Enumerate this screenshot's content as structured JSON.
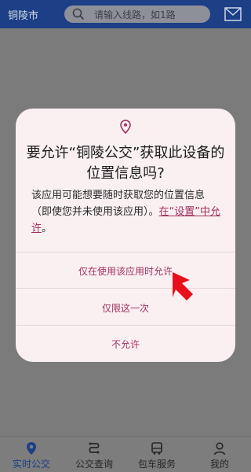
{
  "header": {
    "city": "铜陵市",
    "search_placeholder": "请输入线路，如1路",
    "search_icon": "search-icon",
    "mail_icon": "mail-icon"
  },
  "dialog": {
    "title_line1": "要允许“铜陵公交”获取此设备的",
    "title_line2": "位置信息吗?",
    "message_part1": "该应用可能想要随时获取您的位置信息（即使您并未使用该应用）。",
    "message_link": "在“设置”中允许",
    "message_end": "。",
    "options": [
      {
        "label": "仅在使用该应用时允许"
      },
      {
        "label": "仅限这一次"
      },
      {
        "label": "不允许"
      }
    ]
  },
  "tabs": [
    {
      "label": "实时公交",
      "icon": "location-pin-icon",
      "active": true
    },
    {
      "label": "公交查询",
      "icon": "route-icon",
      "active": false
    },
    {
      "label": "包车服务",
      "icon": "bus-icon",
      "active": false
    },
    {
      "label": "我的",
      "icon": "user-icon",
      "active": false
    }
  ],
  "colors": {
    "header_bg": "#1c3f86",
    "dialog_bg": "#faf0f2",
    "accent": "#a0305f",
    "arrow": "#e8101a"
  }
}
